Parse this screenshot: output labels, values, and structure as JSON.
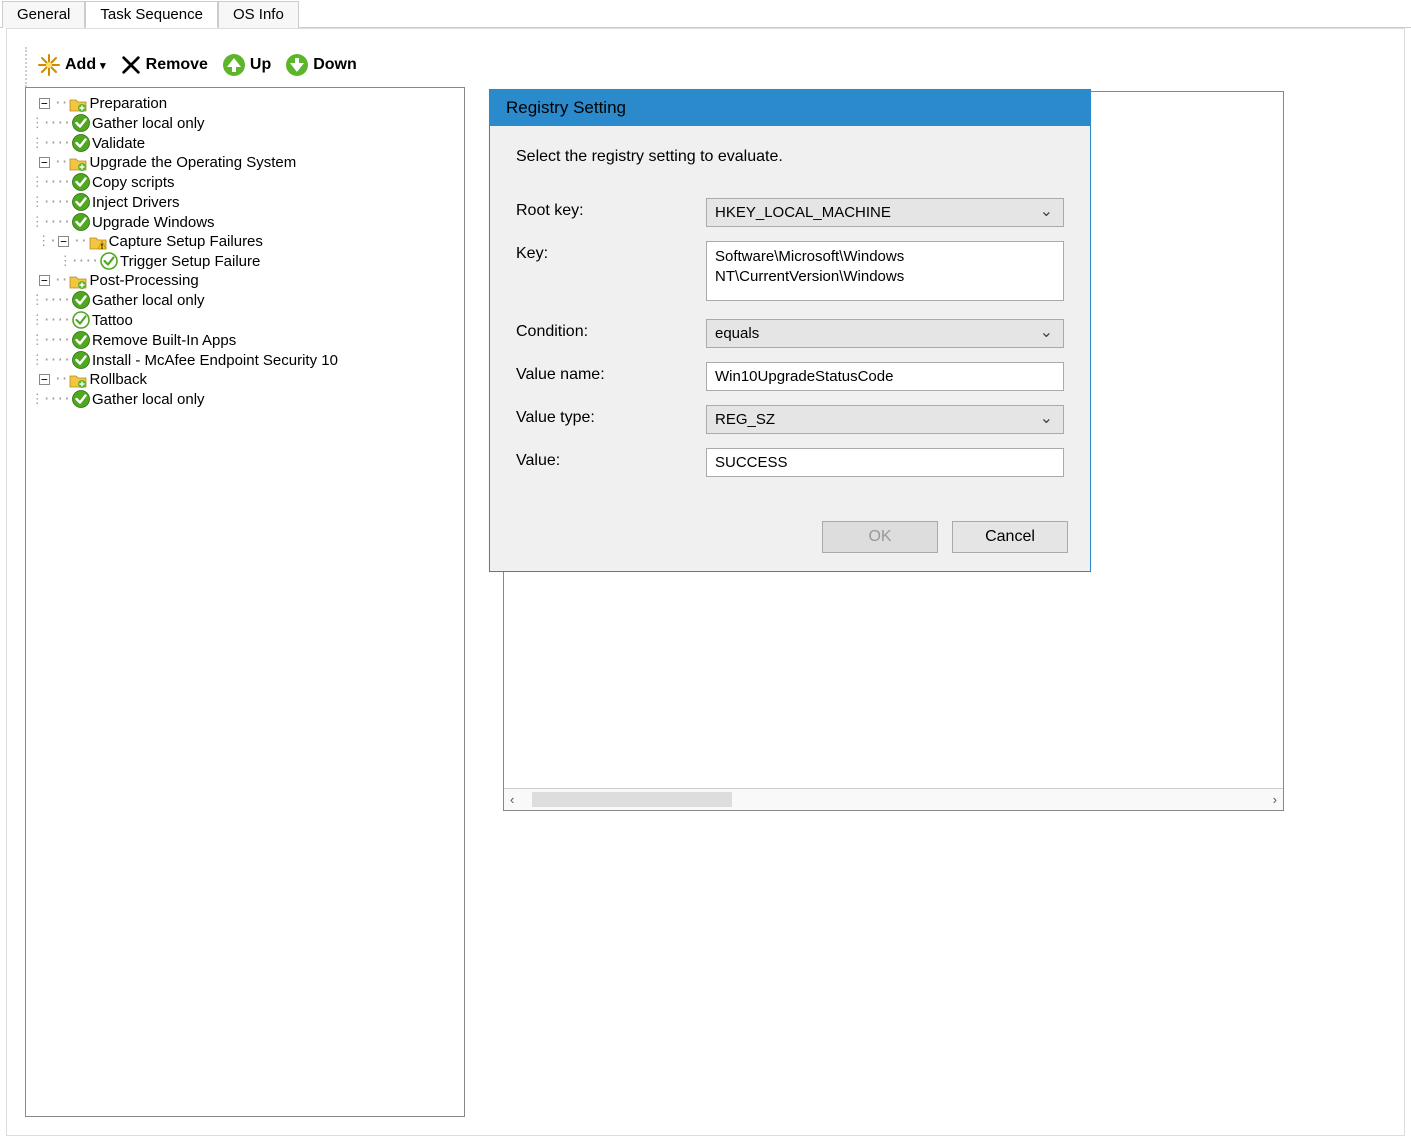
{
  "tabs": {
    "general": "General",
    "task_sequence": "Task Sequence",
    "os_info": "OS Info"
  },
  "toolbar": {
    "add": "Add",
    "remove": "Remove",
    "up": "Up",
    "down": "Down"
  },
  "tree": {
    "preparation": "Preparation",
    "gather_local_only": "Gather local only",
    "validate": "Validate",
    "upgrade_os": "Upgrade the Operating System",
    "copy_scripts": "Copy scripts",
    "inject_drivers": "Inject Drivers",
    "upgrade_windows": "Upgrade Windows",
    "capture_setup_failures": "Capture Setup Failures",
    "trigger_setup_failure": "Trigger Setup Failure",
    "post_processing": "Post-Processing",
    "tattoo": "Tattoo",
    "remove_builtin_apps": "Remove Built-In Apps",
    "install_mcafee": "Install - McAfee Endpoint Security 10",
    "rollback": "Rollback"
  },
  "dialog": {
    "title": "Registry Setting",
    "description": "Select the registry setting to evaluate.",
    "labels": {
      "root_key": "Root key:",
      "key": "Key:",
      "condition": "Condition:",
      "value_name": "Value name:",
      "value_type": "Value type:",
      "value": "Value:"
    },
    "values": {
      "root_key": "HKEY_LOCAL_MACHINE",
      "key": "Software\\Microsoft\\Windows NT\\CurrentVersion\\Windows",
      "condition": "equals",
      "value_name": "Win10UpgradeStatusCode",
      "value_type": "REG_SZ",
      "value": "SUCCESS"
    },
    "buttons": {
      "ok": "OK",
      "cancel": "Cancel"
    }
  }
}
